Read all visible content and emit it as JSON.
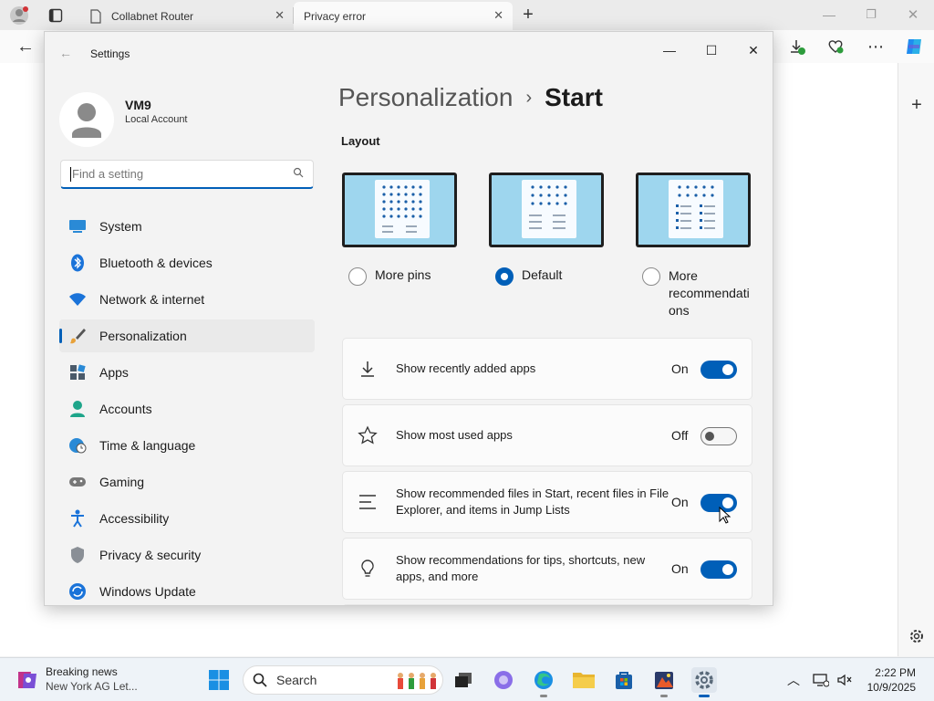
{
  "browser": {
    "tabs": [
      {
        "title": "Collabnet Router"
      },
      {
        "title": "Privacy error"
      }
    ]
  },
  "settings": {
    "window_title": "Settings",
    "profile": {
      "name": "VM9",
      "account_type": "Local Account"
    },
    "search": {
      "placeholder": "Find a setting"
    },
    "nav": [
      {
        "label": "System",
        "icon": "system-icon"
      },
      {
        "label": "Bluetooth & devices",
        "icon": "bluetooth-icon"
      },
      {
        "label": "Network & internet",
        "icon": "wifi-icon"
      },
      {
        "label": "Personalization",
        "icon": "paintbrush-icon",
        "active": true
      },
      {
        "label": "Apps",
        "icon": "apps-icon"
      },
      {
        "label": "Accounts",
        "icon": "accounts-icon"
      },
      {
        "label": "Time & language",
        "icon": "clock-globe-icon"
      },
      {
        "label": "Gaming",
        "icon": "controller-icon"
      },
      {
        "label": "Accessibility",
        "icon": "accessibility-icon"
      },
      {
        "label": "Privacy & security",
        "icon": "shield-icon"
      },
      {
        "label": "Windows Update",
        "icon": "update-icon"
      }
    ],
    "breadcrumb": {
      "parent": "Personalization",
      "separator": "›",
      "current": "Start"
    },
    "layout": {
      "heading": "Layout",
      "options": [
        {
          "label": "More pins",
          "selected": false
        },
        {
          "label": "Default",
          "selected": true
        },
        {
          "label": "More recommendati ons",
          "selected": false
        }
      ]
    },
    "toggles": [
      {
        "label": "Show recently added apps",
        "state": "On",
        "on": true,
        "icon": "download-icon"
      },
      {
        "label": "Show most used apps",
        "state": "Off",
        "on": false,
        "icon": "star-icon"
      },
      {
        "label": "Show recommended files in Start, recent files in File Explorer, and items in Jump Lists",
        "state": "On",
        "on": true,
        "icon": "list-icon"
      },
      {
        "label": "Show recommendations for tips, shortcuts, new apps, and more",
        "state": "On",
        "on": true,
        "icon": "lightbulb-icon"
      }
    ]
  },
  "taskbar": {
    "news_title": "Breaking news",
    "news_subtitle": "New York AG Let...",
    "search_label": "Search",
    "time": "2:22 PM",
    "date": "10/9/2025"
  },
  "colors": {
    "accent": "#005fb8",
    "thumbnail_bg": "#9ed6ee"
  }
}
